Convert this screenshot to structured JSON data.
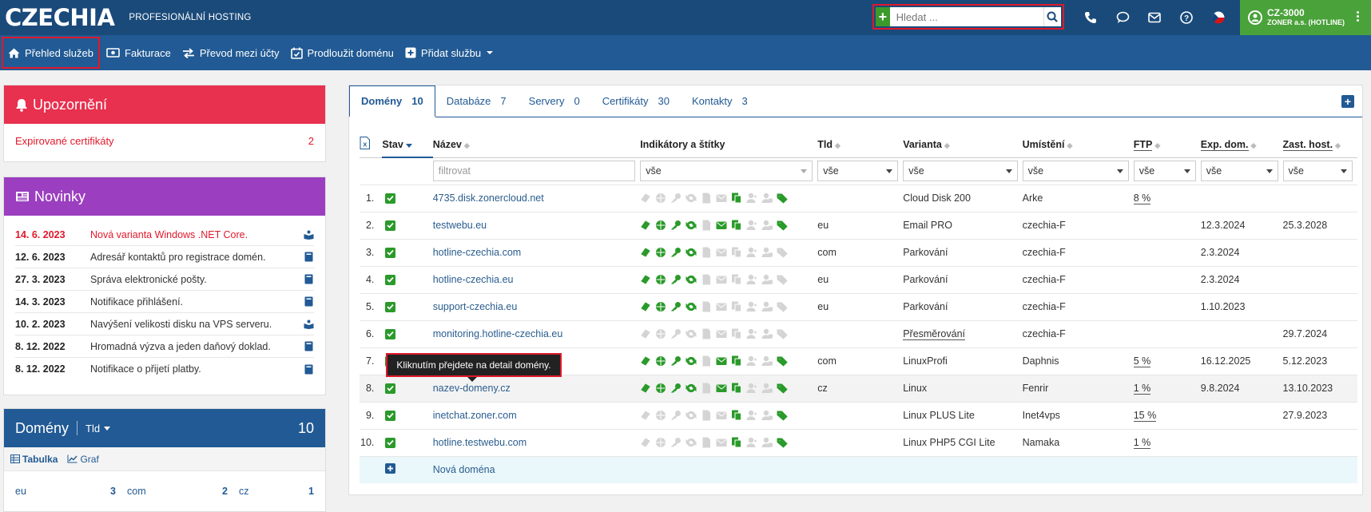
{
  "header": {
    "logo": "CZECHIA",
    "subtitle": "PROFESIONÁLNÍ HOSTING",
    "search_placeholder": "Hledat ...",
    "user_id": "CZ-3000",
    "user_name": "ZONER a.s. (HOTLINE)"
  },
  "nav": {
    "items": [
      {
        "label": "Přehled služeb",
        "icon": "home-icon"
      },
      {
        "label": "Fakturace",
        "icon": "money-icon"
      },
      {
        "label": "Převod mezi účty",
        "icon": "transfer-icon"
      },
      {
        "label": "Prodloužit doménu",
        "icon": "calendar-check-icon"
      },
      {
        "label": "Přidat službu",
        "icon": "plus-square-icon"
      }
    ]
  },
  "alerts": {
    "title": "Upozornění",
    "item_label": "Expirované certifikáty",
    "item_count": "2"
  },
  "news": {
    "title": "Novinky",
    "items": [
      {
        "date": "14. 6. 2023",
        "title": "Nová varianta Windows .NET Core."
      },
      {
        "date": "12. 6. 2023",
        "title": "Adresář kontaktů pro registrace domén."
      },
      {
        "date": "27. 3. 2023",
        "title": "Správa elektronické pošty."
      },
      {
        "date": "14. 3. 2023",
        "title": "Notifikace přihlášení."
      },
      {
        "date": "10. 2. 2023",
        "title": "Navýšení velikosti disku na VPS serveru."
      },
      {
        "date": "8. 12. 2022",
        "title": "Hromadná výzva a jeden daňový doklad."
      },
      {
        "date": "8. 12. 2022",
        "title": "Notifikace o přijetí platby."
      }
    ]
  },
  "domains_panel": {
    "title": "Domény",
    "filter": "Tld",
    "total": "10",
    "tab_table": "Tabulka",
    "tab_graph": "Graf",
    "counts": [
      {
        "tld": "eu",
        "count": "3"
      },
      {
        "tld": "com",
        "count": "2"
      },
      {
        "tld": "cz",
        "count": "1"
      }
    ]
  },
  "tabs": [
    {
      "label": "Domény",
      "count": "10"
    },
    {
      "label": "Databáze",
      "count": "7"
    },
    {
      "label": "Servery",
      "count": "0"
    },
    {
      "label": "Certifikáty",
      "count": "30"
    },
    {
      "label": "Kontakty",
      "count": "3"
    }
  ],
  "table": {
    "headers": {
      "stav": "Stav",
      "nazev": "Název",
      "indikatory": "Indikátory a štítky",
      "tld": "Tld",
      "varianta": "Varianta",
      "umisteni": "Umístění",
      "ftp": "FTP",
      "exp": "Exp. dom.",
      "zast": "Zast. host."
    },
    "filter_placeholder": "filtrovat",
    "filter_all": "vše",
    "rows": [
      {
        "num": "1.",
        "name": "4735.disk.zonercloud.net",
        "tld": "",
        "varianta": "Cloud Disk 200",
        "umisteni": "Arke",
        "ftp": "8 %",
        "exp": "",
        "zast": ""
      },
      {
        "num": "2.",
        "name": "testwebu.eu",
        "tld": "eu",
        "varianta": "Email PRO",
        "umisteni": "czechia-F",
        "ftp": "",
        "exp": "12.3.2024",
        "zast": "25.3.2028"
      },
      {
        "num": "3.",
        "name": "hotline-czechia.com",
        "tld": "com",
        "varianta": "Parkování",
        "umisteni": "czechia-F",
        "ftp": "",
        "exp": "2.3.2024",
        "zast": ""
      },
      {
        "num": "4.",
        "name": "hotline-czechia.eu",
        "tld": "eu",
        "varianta": "Parkování",
        "umisteni": "czechia-F",
        "ftp": "",
        "exp": "2.3.2024",
        "zast": ""
      },
      {
        "num": "5.",
        "name": "support-czechia.eu",
        "tld": "eu",
        "varianta": "Parkování",
        "umisteni": "czechia-F",
        "ftp": "",
        "exp": "1.10.2023",
        "zast": ""
      },
      {
        "num": "6.",
        "name": "monitoring.hotline-czechia.eu",
        "tld": "",
        "varianta": "Přesměrování",
        "umisteni": "czechia-F",
        "ftp": "",
        "exp": "",
        "zast": "29.7.2024"
      },
      {
        "num": "7.",
        "name": "",
        "tld": "com",
        "varianta": "LinuxProfi",
        "umisteni": "Daphnis",
        "ftp": "5 %",
        "exp": "16.12.2025",
        "zast": "5.12.2023"
      },
      {
        "num": "8.",
        "name": "nazev-domeny.cz",
        "tld": "cz",
        "varianta": "Linux",
        "umisteni": "Fenrir",
        "ftp": "1 %",
        "exp": "9.8.2024",
        "zast": "13.10.2023"
      },
      {
        "num": "9.",
        "name": "inetchat.zoner.com",
        "tld": "",
        "varianta": "Linux PLUS Lite",
        "umisteni": "Inet4vps",
        "ftp": "15 %",
        "exp": "",
        "zast": "27.9.2023"
      },
      {
        "num": "10.",
        "name": "hotline.testwebu.com",
        "tld": "",
        "varianta": "Linux PHP5 CGI Lite",
        "umisteni": "Namaka",
        "ftp": "1 %",
        "exp": "",
        "zast": ""
      }
    ],
    "new_domain": "Nová doména"
  },
  "tooltip": "Kliknutím přejdete na detail domény.",
  "colors": {
    "topbar": "#1a4a7a",
    "navbar": "#215a94",
    "accent_green": "#2a9a2a",
    "alert_red": "#e8304f",
    "news_purple": "#9b3fc0",
    "highlight_red": "#e0192b"
  }
}
